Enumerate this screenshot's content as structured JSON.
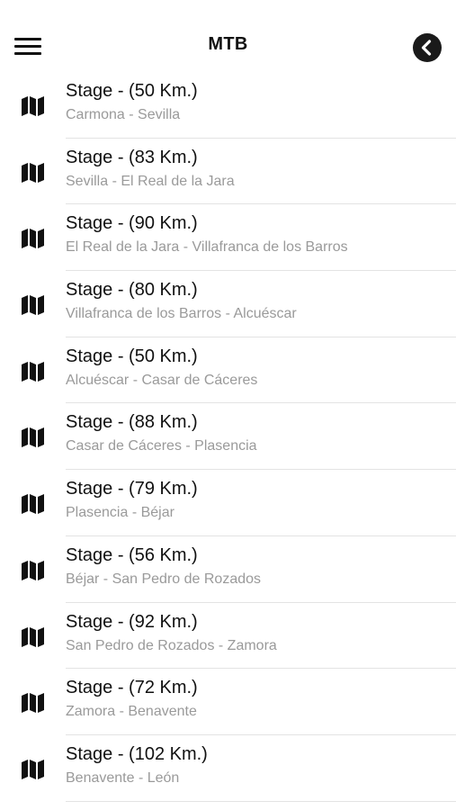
{
  "header": {
    "title": "MTB",
    "menu_icon": "hamburger-menu-icon",
    "back_icon": "chevron-left-circle-icon"
  },
  "stages": [
    {
      "title": "Stage - (50 Km.)",
      "subtitle": "Carmona - Sevilla"
    },
    {
      "title": "Stage - (83 Km.)",
      "subtitle": "Sevilla - El Real de la Jara"
    },
    {
      "title": "Stage - (90 Km.)",
      "subtitle": "El Real de la Jara - Villafranca de los Barros"
    },
    {
      "title": "Stage - (80 Km.)",
      "subtitle": "Villafranca de los Barros - Alcuéscar"
    },
    {
      "title": "Stage - (50 Km.)",
      "subtitle": "Alcuéscar - Casar de Cáceres"
    },
    {
      "title": "Stage - (88 Km.)",
      "subtitle": "Casar de Cáceres - Plasencia"
    },
    {
      "title": "Stage - (79 Km.)",
      "subtitle": "Plasencia - Béjar"
    },
    {
      "title": "Stage - (56 Km.)",
      "subtitle": "Béjar - San Pedro de Rozados"
    },
    {
      "title": "Stage - (92 Km.)",
      "subtitle": "San Pedro de Rozados - Zamora"
    },
    {
      "title": "Stage - (72 Km.)",
      "subtitle": "Zamora - Benavente"
    },
    {
      "title": "Stage - (102 Km.)",
      "subtitle": "Benavente - León"
    }
  ],
  "colors": {
    "text": "#111111",
    "subtitle": "#9a9a9a",
    "divider": "#e3e3e3",
    "back_button": "#1a1a1a"
  }
}
